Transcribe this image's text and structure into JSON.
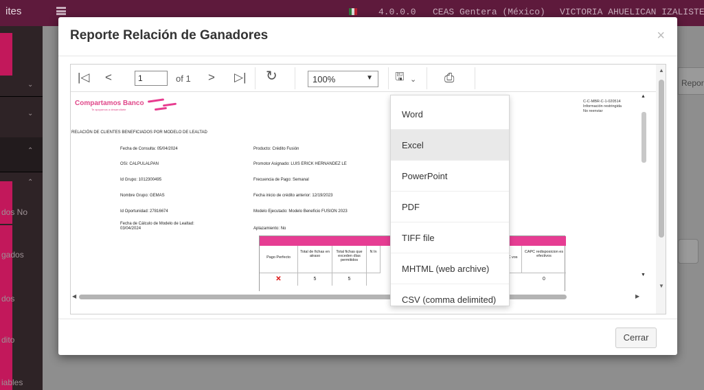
{
  "app": {
    "title": "ites",
    "version": "4.0.0.0",
    "org": "CEAS Gentera (México)",
    "user": "VICTORIA AHUELICAN IZALISTE"
  },
  "sidebar": {
    "items": [
      {
        "label": "dos No"
      },
      {
        "label": "gados"
      },
      {
        "label": "dos"
      },
      {
        "label": "dito"
      },
      {
        "label": "iables"
      }
    ]
  },
  "background": {
    "right_text": "Repor"
  },
  "modal": {
    "title": "Reporte Relación de Ganadores",
    "close_label": "Cerrar"
  },
  "viewer": {
    "page_value": "1",
    "of_label": "of 1",
    "zoom": "100%"
  },
  "report": {
    "logo": "Compartamos Banco",
    "logo_sub": "Te apoyamos a desarrollarte",
    "right_note": [
      "C-C-MBR-C-1-020514",
      "Información restringida",
      "No reenviar"
    ],
    "heading": "RELACIÓN DE CLIENTES BENEFICIADOS POR MODELO DE LEALTAD",
    "left_fields": [
      "Fecha de Consulta: 05/04/2024",
      "OSi: CALPULALPAN",
      "Id Grupo: 1012300495",
      "Nombre Grupo: GEMAS",
      "Id Oportunidad: 27816674",
      "Fecha de Cálculo de Modelo de Lealtad:",
      "03/04/2024"
    ],
    "right_fields": [
      "Producto: Crédito Fusión",
      "Promotor Asignado: LUIS ERICK HERNANDEZ LE",
      "Frecuencia de Pago: Semanal",
      "Fecha inicio de crédito anterior: 12/19/2023",
      "Modelo Ejecutado: Modelo Beneficio FUSION 2023",
      "Aplazamiento: No"
    ],
    "table": {
      "header": "Condicion",
      "columns": [
        "Pago Perfecto",
        "Total de fichas en atraso",
        "Total fichas que exceden días permitidos",
        "N In",
        "C vos",
        "CAPC redisposicion es efectivos"
      ],
      "row": [
        "✕",
        "5",
        "5",
        "",
        "os",
        "0"
      ]
    }
  },
  "export_menu": {
    "items": [
      "Word",
      "Excel",
      "PowerPoint",
      "PDF",
      "TIFF file",
      "MHTML (web archive)",
      "CSV (comma delimited)"
    ],
    "hover_index": 1
  }
}
